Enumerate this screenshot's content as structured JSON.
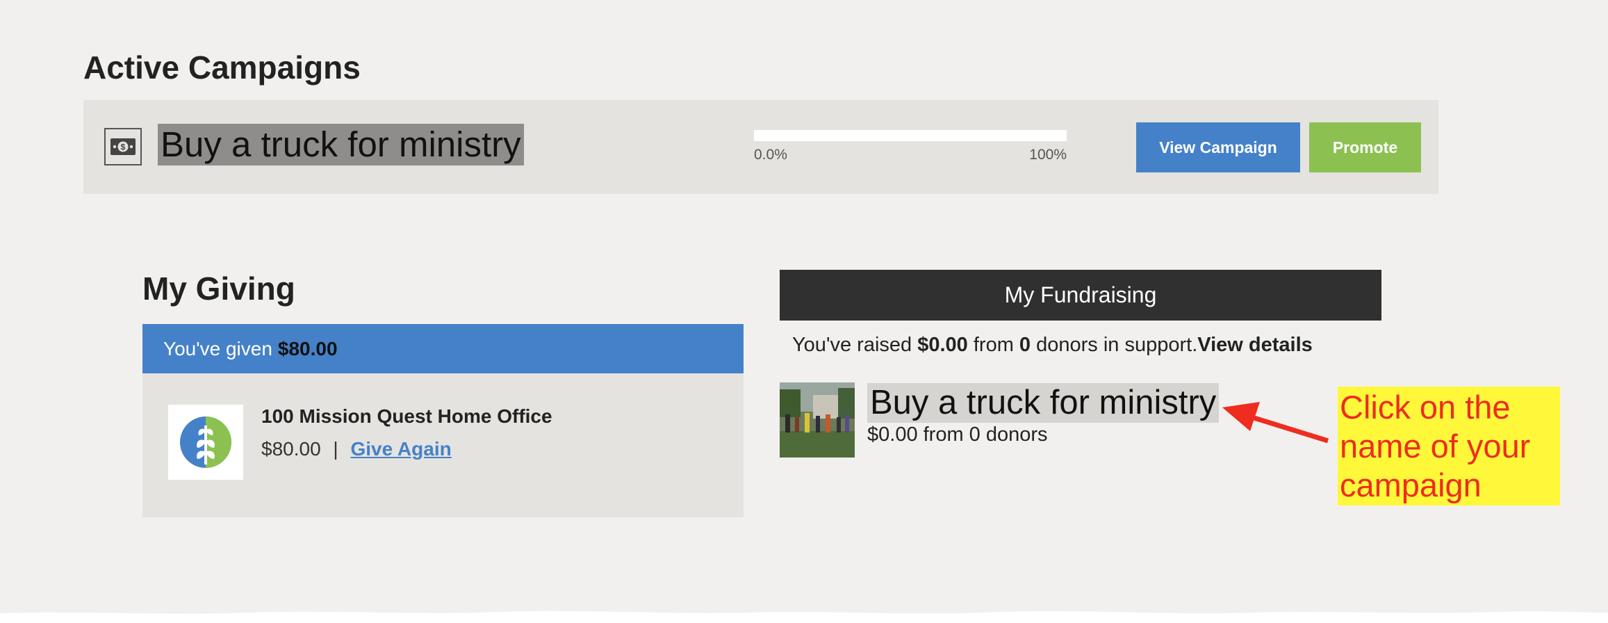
{
  "active_campaigns": {
    "heading": "Active Campaigns",
    "campaign": {
      "name": "Buy a truck for ministry",
      "icon": "money-icon",
      "progress": {
        "fraction": 0.0,
        "min_label": "0.0%",
        "max_label": "100%"
      },
      "view_button": "View Campaign",
      "promote_button": "Promote"
    }
  },
  "my_giving": {
    "heading": "My Giving",
    "given_prefix": "You've given",
    "given_amount": "$80.00",
    "org": {
      "logo": "wheat-leaf-logo",
      "name": "100 Mission Quest Home Office",
      "amount": "$80.00",
      "separator": "|",
      "give_again": "Give Again"
    }
  },
  "my_fundraising": {
    "heading": "My Fundraising",
    "raised_prefix": "You've raised",
    "raised_amount": "$0.00",
    "raised_from": "from",
    "donor_count": "0",
    "raised_suffix": "donors in support.",
    "view_details": "View details",
    "campaign": {
      "thumbnail": "campaign-photo",
      "title": "Buy a truck for ministry",
      "subtitle": "$0.00 from 0 donors"
    }
  },
  "annotation": {
    "lines": [
      "Click on the",
      "name of your",
      "campaign"
    ],
    "arrow": "red-arrow"
  },
  "colors": {
    "page_bg": "#f1f0ee",
    "panel_bg": "#e5e3df",
    "accent_blue": "#4581c9",
    "accent_green": "#8cc152",
    "header_dark": "#303030",
    "callout_bg": "#fff83a",
    "callout_text": "#ee2c1f"
  }
}
